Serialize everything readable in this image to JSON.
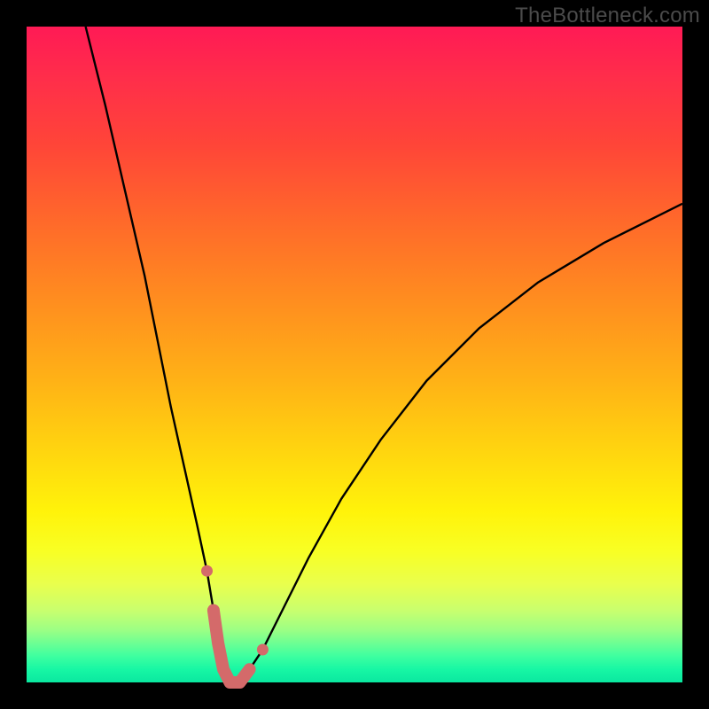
{
  "watermark": "TheBottleneck.com",
  "colors": {
    "frame": "#000000",
    "curve": "#000000",
    "highlight_stroke": "#d46a6a",
    "highlight_fill": "#d46a6a"
  },
  "chart_data": {
    "type": "line",
    "title": "",
    "xlabel": "",
    "ylabel": "",
    "xlim": [
      0,
      100
    ],
    "ylim": [
      0,
      100
    ],
    "series": [
      {
        "name": "bottleneck-curve",
        "x": [
          9,
          12,
          15,
          18,
          20,
          22,
          24,
          26,
          27.5,
          28.5,
          29.2,
          30,
          31,
          32.5,
          34,
          36,
          39,
          43,
          48,
          54,
          61,
          69,
          78,
          88,
          100
        ],
        "y": [
          100,
          88,
          75,
          62,
          52,
          42,
          33,
          24,
          17,
          11,
          6,
          2,
          0,
          0,
          2,
          5,
          11,
          19,
          28,
          37,
          46,
          54,
          61,
          67,
          73
        ]
      }
    ],
    "highlight_region": {
      "x": [
        27.5,
        28.5,
        29.2,
        30,
        31,
        32.5,
        34,
        36
      ],
      "y": [
        17,
        11,
        6,
        2,
        0,
        0,
        2,
        5
      ]
    }
  }
}
